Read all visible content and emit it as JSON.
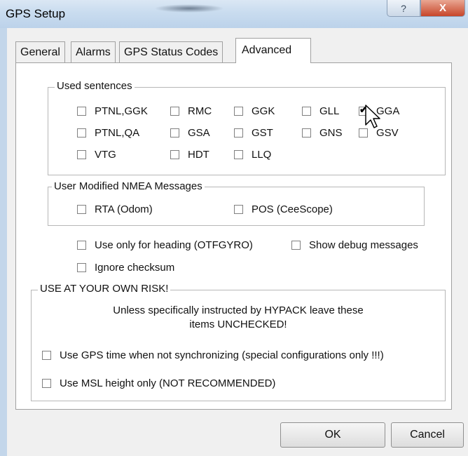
{
  "window": {
    "title": "GPS Setup",
    "help_label": "?",
    "close_label": "X"
  },
  "tabs": [
    {
      "label": "General"
    },
    {
      "label": "Alarms"
    },
    {
      "label": "GPS Status Codes"
    },
    {
      "label": "Advanced",
      "active": true
    }
  ],
  "used_sentences": {
    "label": "Used sentences",
    "items": [
      {
        "label": "PTNL,GGK",
        "checked": false
      },
      {
        "label": "RMC",
        "checked": false
      },
      {
        "label": "GGK",
        "checked": false
      },
      {
        "label": "GLL",
        "checked": false
      },
      {
        "label": "GGA",
        "checked": true
      },
      {
        "label": "PTNL,QA",
        "checked": false
      },
      {
        "label": "GSA",
        "checked": false
      },
      {
        "label": "GST",
        "checked": false
      },
      {
        "label": "GNS",
        "checked": false
      },
      {
        "label": "GSV",
        "checked": false
      },
      {
        "label": "VTG",
        "checked": false
      },
      {
        "label": "HDT",
        "checked": false
      },
      {
        "label": "LLQ",
        "checked": false
      }
    ]
  },
  "user_modified": {
    "label": "User Modified NMEA Messages",
    "items": [
      {
        "label": "RTA (Odom)",
        "checked": false
      },
      {
        "label": "POS (CeeScope)",
        "checked": false
      }
    ]
  },
  "options": {
    "heading_only": {
      "label": "Use only for heading (OTFGYRO)",
      "checked": false
    },
    "debug": {
      "label": "Show debug messages",
      "checked": false
    },
    "ignore_checksum": {
      "label": "Ignore checksum",
      "checked": false
    }
  },
  "risk": {
    "label": "USE AT YOUR OWN RISK!",
    "warning_line1": "Unless specifically instructed by HYPACK leave these",
    "warning_line2": "items UNCHECKED!",
    "gps_time": {
      "label": "Use GPS time when not synchronizing (special configurations only !!!)",
      "checked": false
    },
    "msl_height": {
      "label": "Use MSL height only (NOT RECOMMENDED)",
      "checked": false
    }
  },
  "buttons": {
    "ok": "OK",
    "cancel": "Cancel"
  }
}
